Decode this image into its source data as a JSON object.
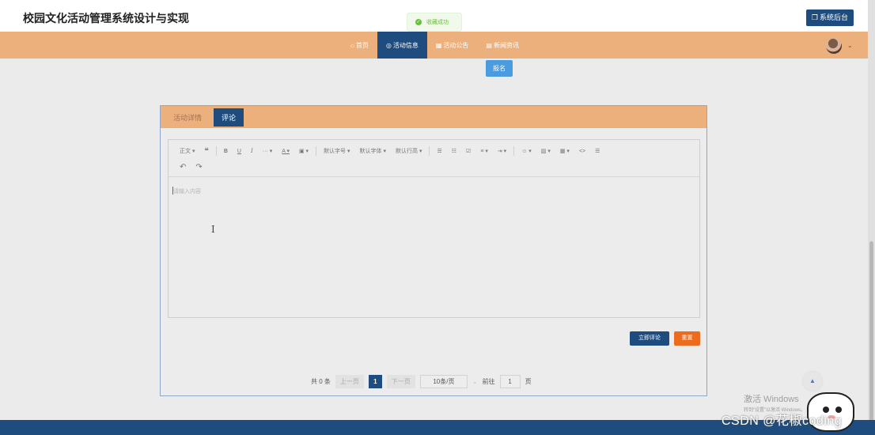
{
  "header": {
    "site_title": "校园文化活动管理系统设计与实现",
    "admin_button": "系统后台"
  },
  "toast": {
    "message": "收藏成功"
  },
  "nav": {
    "items": [
      {
        "label": "首页",
        "icon": "home-icon"
      },
      {
        "label": "活动信息",
        "icon": "target-icon",
        "active": true
      },
      {
        "label": "活动公告",
        "icon": "grid-icon"
      },
      {
        "label": "新闻资讯",
        "icon": "news-icon"
      }
    ]
  },
  "signup_button": "报名",
  "tabs": {
    "detail": "活动详情",
    "comment": "评论"
  },
  "editor": {
    "toolbar": {
      "paragraph": "正文",
      "quote": "❝",
      "bold": "B",
      "underline": "U",
      "italic": "I",
      "more": "···",
      "font_color": "A",
      "bg_color": "A",
      "font_size": "默认字号",
      "font_family": "默认字体",
      "line_height": "默认行高",
      "undo": "↶",
      "redo": "↷"
    },
    "placeholder": "请输入内容"
  },
  "actions": {
    "submit": "立即评论",
    "reset": "重置"
  },
  "pagination": {
    "total_text": "共 0 条",
    "prev": "上一页",
    "current_page": "1",
    "next": "下一页",
    "page_size": "10条/页",
    "goto_prefix": "前往",
    "goto_value": "1",
    "goto_suffix": "页"
  },
  "watermark": {
    "activate_title": "激活 Windows",
    "activate_hint": "转到“设置”以激活 Windows。",
    "csdn": "CSDN @花椒coding"
  },
  "colors": {
    "primary": "#1e4c7e",
    "accent": "#ecb07c",
    "danger": "#ed6b1e",
    "link": "#4a9be0"
  }
}
